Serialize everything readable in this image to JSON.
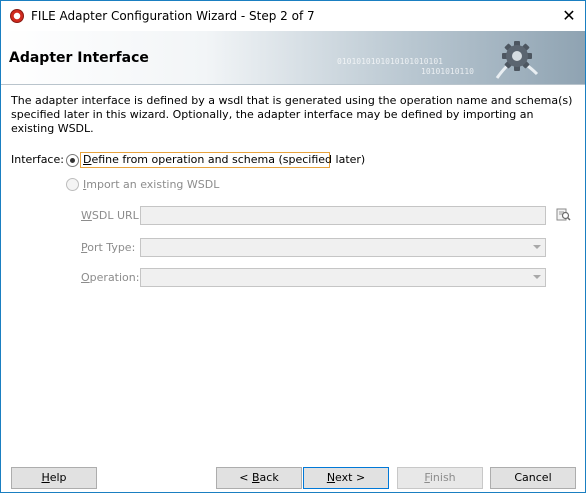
{
  "window": {
    "title": "FILE Adapter Configuration Wizard - Step 2 of 7",
    "close_glyph": "✕"
  },
  "header": {
    "title": "Adapter Interface",
    "decor_binary_1": "0101010101010101010101",
    "decor_binary_2": "10101010110",
    "icon": "gear-icon"
  },
  "description": "The adapter interface is defined by a wsdl that is generated using the operation name and schema(s) specified later in this wizard.  Optionally, the adapter interface may be defined by importing an existing WSDL.",
  "interface": {
    "label": "Interface:",
    "option_define": {
      "mnemonic": "D",
      "rest": "efine from operation and schema (specified later)",
      "selected": true
    },
    "option_import": {
      "mnemonic": "I",
      "rest": "mport an existing WSDL",
      "selected": false
    }
  },
  "fields": {
    "wsdl_url": {
      "mnemonic": "W",
      "rest": "SDL URL:",
      "value": ""
    },
    "port_type": {
      "mnemonic": "P",
      "rest": "ort Type:",
      "value": ""
    },
    "operation": {
      "mnemonic": "O",
      "rest": "peration:",
      "value": ""
    }
  },
  "buttons": {
    "help": {
      "mnemonic": "H",
      "rest": "elp"
    },
    "back": {
      "prefix": "< ",
      "mnemonic": "B",
      "rest": "ack"
    },
    "next": {
      "mnemonic": "N",
      "rest": "ext >"
    },
    "finish": {
      "mnemonic": "F",
      "rest": "inish"
    },
    "cancel": {
      "label": "Cancel"
    }
  },
  "colors": {
    "focus_border": "#e8a33d",
    "default_button_border": "#0078d7",
    "disabled_text": "#8c8c8c"
  }
}
